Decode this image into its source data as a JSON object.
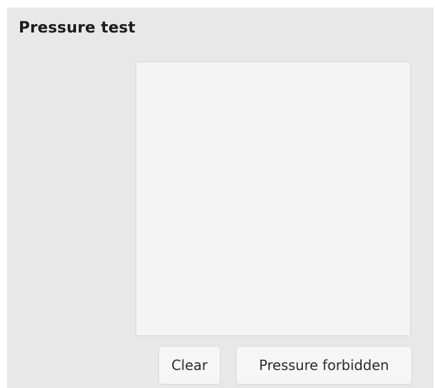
{
  "panel": {
    "title": "Pressure test"
  },
  "buttons": {
    "clear_label": "Clear",
    "forbid_label": "Pressure forbidden"
  },
  "colors": {
    "panel_background": "#e7e8e7",
    "canvas_background": "#f3f4f3",
    "button_background": "#f6f6f6"
  }
}
